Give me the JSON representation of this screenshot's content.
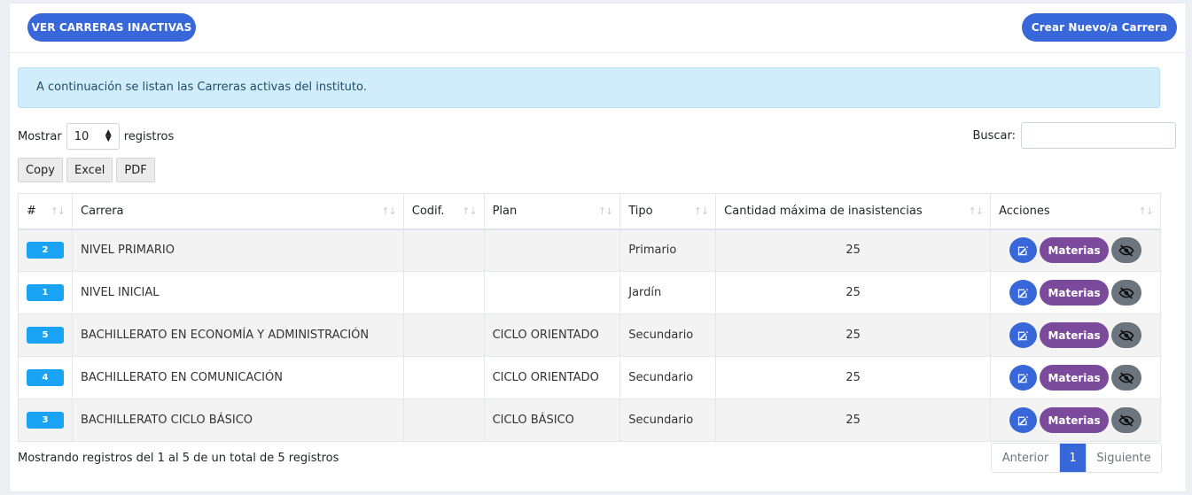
{
  "header": {
    "inactive_label": "VER CARRERAS INACTIVAS",
    "new_label": "Crear Nuevo/a Carrera"
  },
  "alert": {
    "text": "A continuación se listan las Carreras activas del instituto."
  },
  "length": {
    "prefix": "Mostrar",
    "value": "10",
    "suffix": "registros"
  },
  "search": {
    "label": "Buscar:",
    "value": ""
  },
  "export": {
    "copy": "Copy",
    "excel": "Excel",
    "pdf": "PDF"
  },
  "table": {
    "headers": [
      "#",
      "Carrera",
      "Codif.",
      "Plan",
      "Tipo",
      "Cantidad máxima de inasistencias",
      "Acciones"
    ],
    "rows": [
      {
        "id": "2",
        "carrera": "NIVEL PRIMARIO",
        "codif": "",
        "plan": "",
        "tipo": "Primario",
        "max": "25"
      },
      {
        "id": "1",
        "carrera": "NIVEL INICIAL",
        "codif": "",
        "plan": "",
        "tipo": "Jardín",
        "max": "25"
      },
      {
        "id": "5",
        "carrera": "BACHILLERATO EN ECONOMÍA Y ADMINISTRACIÓN",
        "codif": "",
        "plan": "CICLO ORIENTADO",
        "tipo": "Secundario",
        "max": "25"
      },
      {
        "id": "4",
        "carrera": "BACHILLERATO EN COMUNICACIÓN",
        "codif": "",
        "plan": "CICLO ORIENTADO",
        "tipo": "Secundario",
        "max": "25"
      },
      {
        "id": "3",
        "carrera": "BACHILLERATO CICLO BÁSICO",
        "codif": "",
        "plan": "CICLO BÁSICO",
        "tipo": "Secundario",
        "max": "25"
      }
    ],
    "materias_label": "Materias"
  },
  "footer": {
    "info": "Mostrando registros del 1 al 5 de un total de 5 registros",
    "prev": "Anterior",
    "page": "1",
    "next": "Siguiente"
  }
}
